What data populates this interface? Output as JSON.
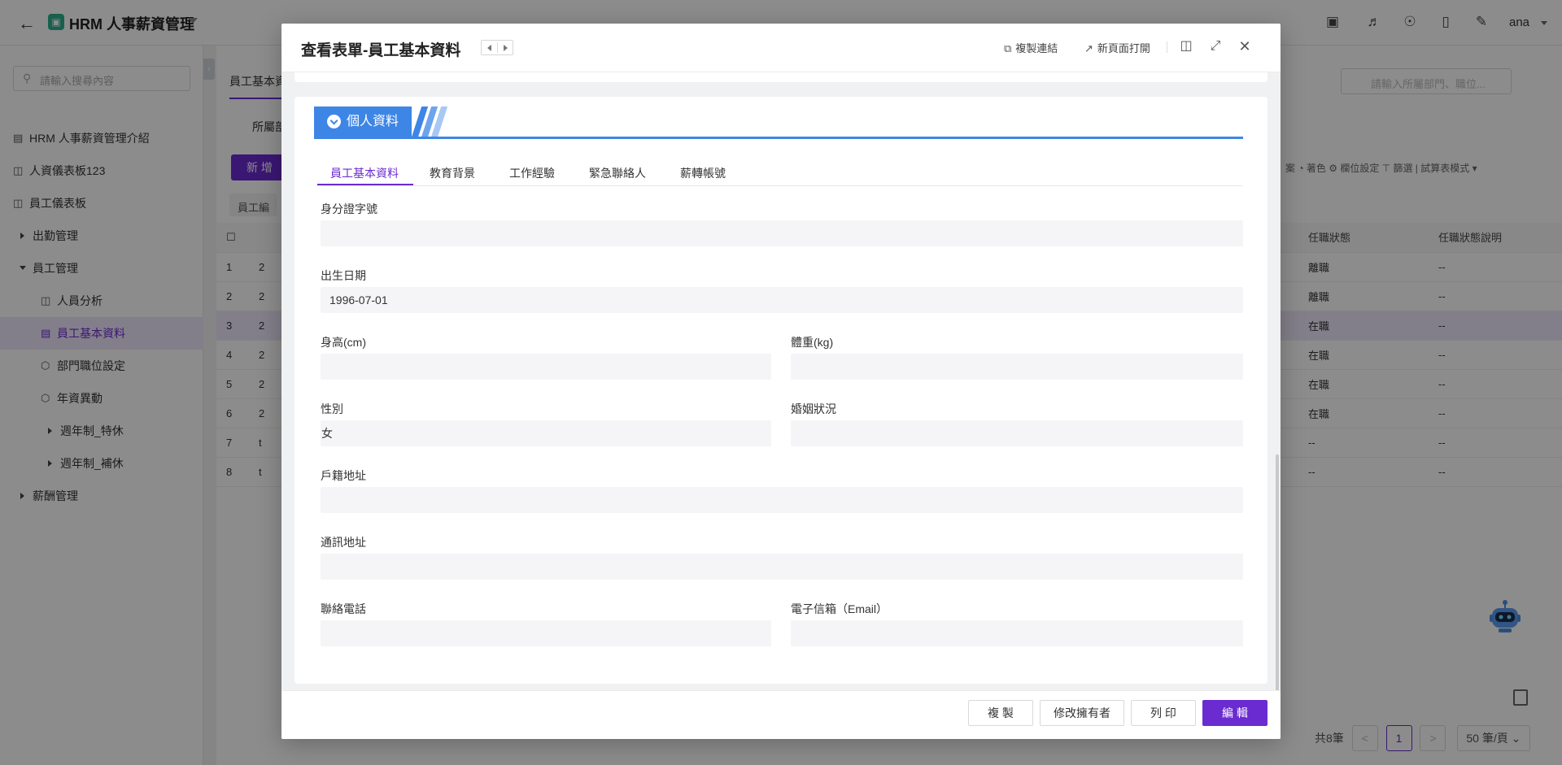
{
  "app": {
    "title": "HRM 人事薪資管理",
    "logo_glyph": "▣",
    "user": "ana",
    "top_icons": [
      "monitor-icon",
      "bell-icon",
      "headset-icon",
      "bookmark-icon",
      "add-user-icon"
    ]
  },
  "sidebar": {
    "search_placeholder": "請輸入搜尋內容",
    "items": [
      {
        "label": "HRM 人事薪資管理介紹",
        "icon": "table-icon"
      },
      {
        "label": "人資儀表板123",
        "icon": "dashboard-icon"
      },
      {
        "label": "員工儀表板",
        "icon": "dashboard-icon"
      },
      {
        "label": "出勤管理",
        "icon": "expand-icon"
      },
      {
        "label": "員工管理",
        "icon": "collapse-icon"
      },
      {
        "label": "人員分析",
        "icon": "dashboard-icon"
      },
      {
        "label": "員工基本資料",
        "icon": "form-icon"
      },
      {
        "label": "部門職位設定",
        "icon": "cube-icon"
      },
      {
        "label": "年資異動",
        "icon": "cube-icon"
      },
      {
        "label": "週年制_特休",
        "icon": "expand-icon"
      },
      {
        "label": "週年制_補休",
        "icon": "expand-icon"
      },
      {
        "label": "薪酬管理",
        "icon": "expand-icon"
      }
    ]
  },
  "main": {
    "tab_label": "員工基本資",
    "filter_label": "所屬部",
    "add_button": "新 增",
    "search_placeholder": "請輸入所屬部門、職位...",
    "toolbar_right": "案   ◔ 著色   ⚙ 欄位設定   ⊤ 篩選   |   試算表模式 ▾",
    "chip_label": "員工編",
    "table": {
      "headers": [
        "",
        "",
        "任職狀態",
        "任職狀態說明"
      ],
      "rows": [
        {
          "no": "1",
          "c": "2",
          "status": "離職",
          "desc": "--"
        },
        {
          "no": "2",
          "c": "2",
          "status": "離職",
          "desc": "--"
        },
        {
          "no": "3",
          "c": "2",
          "status": "在職",
          "desc": "--"
        },
        {
          "no": "4",
          "c": "2",
          "status": "在職",
          "desc": "--"
        },
        {
          "no": "5",
          "c": "2",
          "status": "在職",
          "desc": "--"
        },
        {
          "no": "6",
          "c": "2",
          "status": "在職",
          "desc": "--"
        },
        {
          "no": "7",
          "c": "t",
          "status": "--",
          "desc": "--"
        },
        {
          "no": "8",
          "c": "t",
          "status": "--",
          "desc": "--"
        }
      ]
    },
    "pager": {
      "total": "共8筆",
      "prev": "<",
      "current": "1",
      "next": ">",
      "page_size": "50 筆/頁 ⌄"
    }
  },
  "modal": {
    "title": "查看表單-員工基本資料",
    "actions": {
      "copy_link": "複製連結",
      "open_new_page": "新頁面打開"
    },
    "section_title": "個人資料",
    "tabs": [
      "員工基本資料",
      "教育背景",
      "工作經驗",
      "緊急聯絡人",
      "薪轉帳號"
    ],
    "fields": {
      "id_number": {
        "label": "身分證字號",
        "value": ""
      },
      "birth_date": {
        "label": "出生日期",
        "value": "1996-07-01"
      },
      "height": {
        "label": "身高(cm)",
        "value": ""
      },
      "weight": {
        "label": "體重(kg)",
        "value": ""
      },
      "gender": {
        "label": "性別",
        "value": "女"
      },
      "marital": {
        "label": "婚姻狀況",
        "value": ""
      },
      "household_address": {
        "label": "戶籍地址",
        "value": ""
      },
      "mailing_address": {
        "label": "通訊地址",
        "value": ""
      },
      "phone": {
        "label": "聯絡電話",
        "value": ""
      },
      "email": {
        "label": "電子信箱（Email）",
        "value": ""
      }
    },
    "footer": {
      "copy": "複 製",
      "change_owner": "修改擁有者",
      "print": "列 印",
      "edit": "編 輯"
    }
  },
  "colors": {
    "accent": "#6a2bd1",
    "section_blue": "#3d86e6",
    "field_bg": "#f5f5f7"
  }
}
